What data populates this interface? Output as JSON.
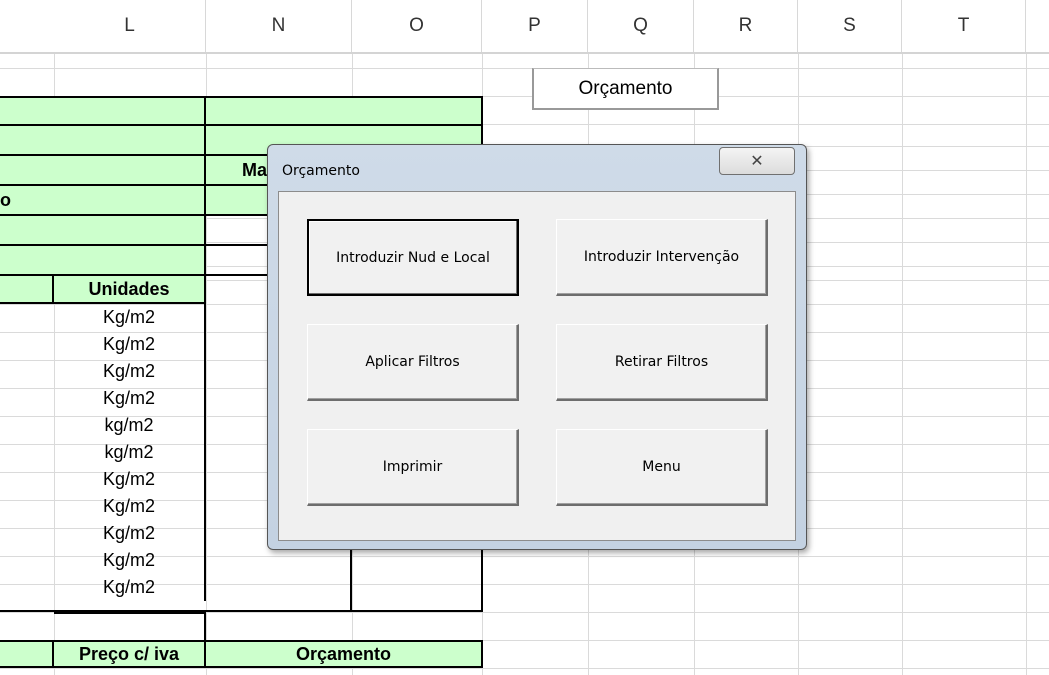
{
  "columns": [
    "L",
    "N",
    "O",
    "P",
    "Q",
    "R",
    "S",
    "T"
  ],
  "sheet": {
    "title_cell": "Orçamento",
    "partial_left_text": "o",
    "partial_header_text": "Ma",
    "units_header": "Unidades",
    "units": [
      "Kg/m2",
      "Kg/m2",
      "Kg/m2",
      "Kg/m2",
      "kg/m2",
      "kg/m2",
      "Kg/m2",
      "Kg/m2",
      "Kg/m2",
      "Kg/m2",
      "Kg/m2"
    ],
    "price_header": "Preço c/ iva",
    "budget_header": "Orçamento"
  },
  "dialog": {
    "title": "Orçamento",
    "close_glyph": "✕",
    "buttons": {
      "introduce_nud": "Introduzir Nud e Local",
      "introduce_intervention": "Introduzir Intervenção",
      "apply_filters": "Aplicar Filtros",
      "remove_filters": "Retirar Filtros",
      "print": "Imprimir",
      "menu": "Menu"
    }
  },
  "colors": {
    "cell_green": "#ccffcc",
    "dialog_frame": "#c4d2e2",
    "dialog_client": "#f0f0f0"
  }
}
